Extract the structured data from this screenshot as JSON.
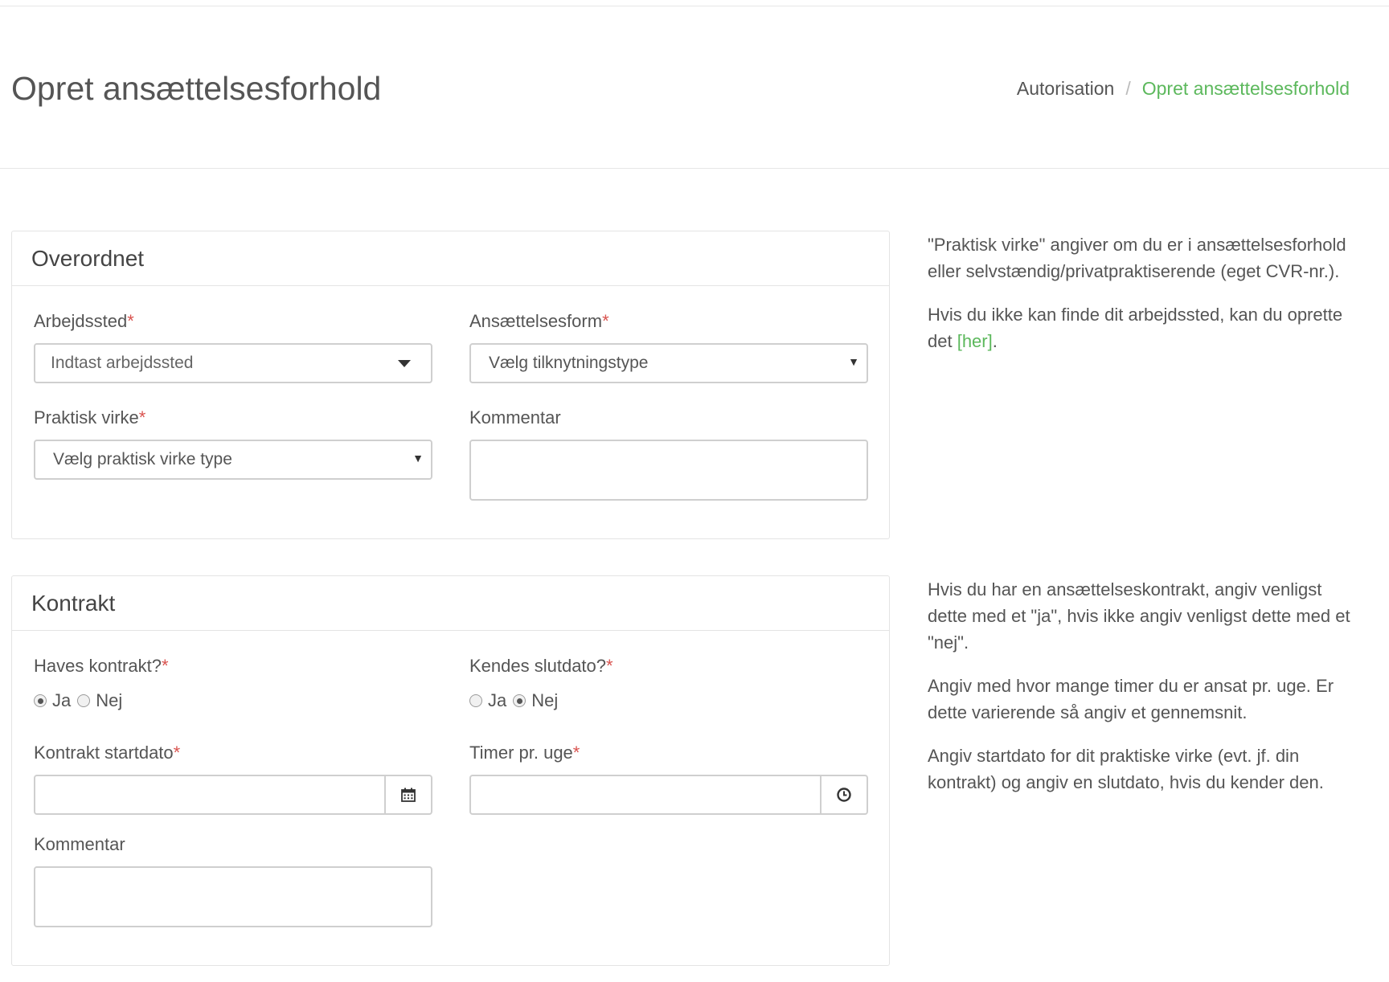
{
  "page": {
    "title": "Opret ansættelsesforhold",
    "breadcrumb": [
      "Autorisation",
      "Opret ansættelsesforhold"
    ],
    "breadcrumb_separator": "/"
  },
  "colors": {
    "accent": "#5cb85c",
    "required": "#d9534f"
  },
  "overordnet": {
    "heading": "Overordnet",
    "arbejdssted": {
      "label": "Arbejdssted",
      "placeholder": "Indtast arbejdssted"
    },
    "ansaettelsesform": {
      "label": "Ansættelsesform",
      "selected": "Vælg tilknytningstype"
    },
    "praktisk_virke": {
      "label": "Praktisk virke",
      "selected": "Vælg praktisk virke type"
    },
    "kommentar": {
      "label": "Kommentar",
      "value": ""
    }
  },
  "kontrakt": {
    "heading": "Kontrakt",
    "haves_kontrakt": {
      "label": "Haves kontrakt?",
      "options": [
        "Ja",
        "Nej"
      ],
      "selected": "Ja"
    },
    "kendes_slutdato": {
      "label": "Kendes slutdato?",
      "options": [
        "Ja",
        "Nej"
      ],
      "selected": "Nej"
    },
    "startdato": {
      "label": "Kontrakt startdato",
      "value": "",
      "icon": "calendar-icon"
    },
    "timer": {
      "label": "Timer pr. uge",
      "value": "",
      "icon": "clock-icon"
    },
    "kommentar": {
      "label": "Kommentar",
      "value": ""
    }
  },
  "required_marker": "*",
  "help": {
    "overordnet": {
      "p1": "\"Praktisk virke\" angiver om du er i ansættelsesforhold eller selvstændig/privatpraktiserende (eget CVR-nr.).",
      "p2_before": "Hvis du ikke kan finde dit arbejdssted, kan du oprette det ",
      "p2_link": "[her]",
      "p2_after": "."
    },
    "kontrakt": {
      "p1": "Hvis du har en ansættelseskontrakt, angiv venligst dette med et \"ja\", hvis ikke angiv venligst dette med et \"nej\".",
      "p2": "Angiv med hvor mange timer du er ansat pr. uge. Er dette varierende så angiv et gennemsnit.",
      "p3": "Angiv startdato for dit praktiske virke (evt. jf. din kontrakt) og angiv en slutdato, hvis du kender den."
    }
  }
}
